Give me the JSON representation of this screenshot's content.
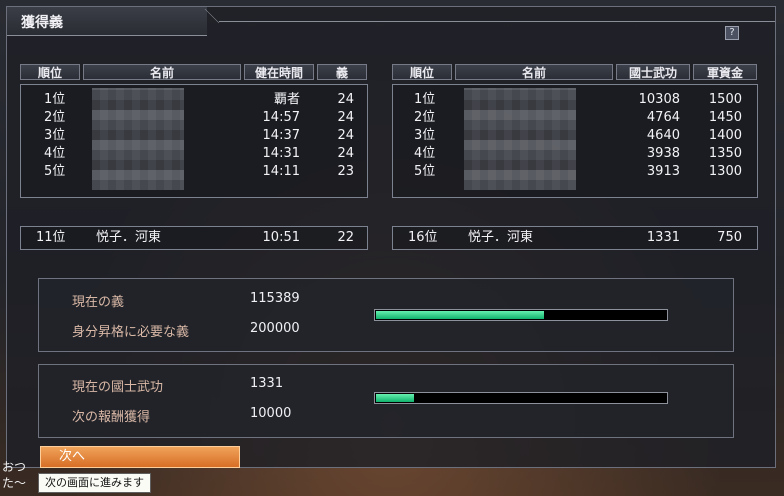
{
  "window": {
    "title": "獲得義",
    "help_label": "?"
  },
  "left_table": {
    "headers": [
      "順位",
      "名前",
      "健在時間",
      "義"
    ],
    "rows": [
      {
        "rank": "1位",
        "time": "覇者",
        "gi": "24"
      },
      {
        "rank": "2位",
        "time": "14:57",
        "gi": "24"
      },
      {
        "rank": "3位",
        "time": "14:37",
        "gi": "24"
      },
      {
        "rank": "4位",
        "time": "14:31",
        "gi": "24"
      },
      {
        "rank": "5位",
        "time": "14:11",
        "gi": "23"
      }
    ],
    "self": {
      "rank": "11位",
      "name": "悦子．河東",
      "time": "10:51",
      "gi": "22"
    }
  },
  "right_table": {
    "headers": [
      "順位",
      "名前",
      "國士武功",
      "軍資金"
    ],
    "rows": [
      {
        "rank": "1位",
        "bukou": "10308",
        "gunshi": "1500"
      },
      {
        "rank": "2位",
        "bukou": "4764",
        "gunshi": "1450"
      },
      {
        "rank": "3位",
        "bukou": "4640",
        "gunshi": "1400"
      },
      {
        "rank": "4位",
        "bukou": "3938",
        "gunshi": "1350"
      },
      {
        "rank": "5位",
        "bukou": "3913",
        "gunshi": "1300"
      }
    ],
    "self": {
      "rank": "16位",
      "name": "悦子．河東",
      "bukou": "1331",
      "gunshi": "750"
    }
  },
  "stats_gi": {
    "current_label": "現在の義",
    "current_value": "115389",
    "required_label": "身分昇格に必要な義",
    "required_value": "200000",
    "progress": 0.58
  },
  "stats_bukou": {
    "current_label": "現在の國士武功",
    "current_value": "1331",
    "next_label": "次の報酬獲得",
    "next_value": "10000",
    "progress": 0.13
  },
  "next_button": {
    "label": "次へ"
  },
  "tooltip": {
    "text": "次の画面に進みます"
  },
  "chat": {
    "line1": "おつ",
    "line2": "た〜"
  },
  "colors": {
    "accent_orange": "#e07a32",
    "bar_green": "#22c97f",
    "label_tan": "#d9b8a6"
  }
}
